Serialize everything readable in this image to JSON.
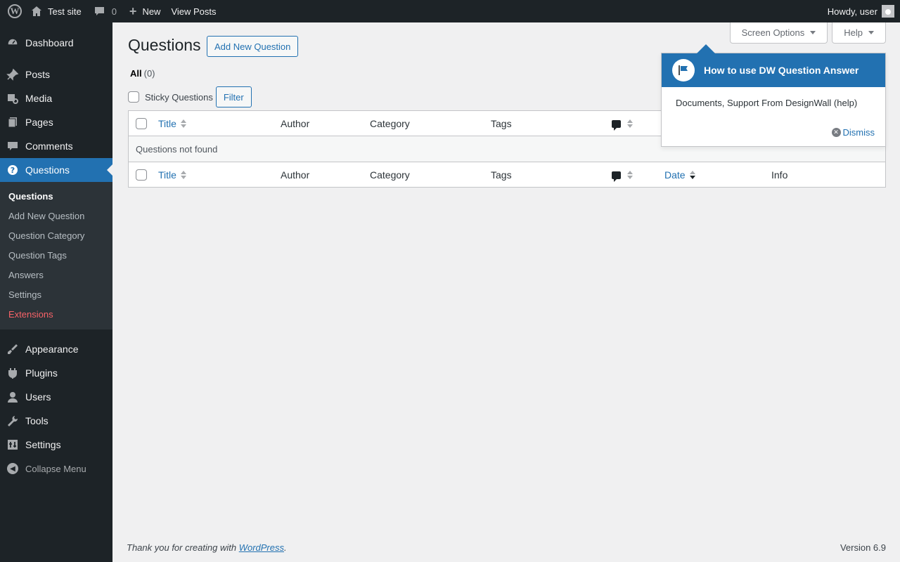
{
  "adminbar": {
    "site_name": "Test site",
    "comments_count": "0",
    "new_label": "New",
    "view_posts": "View Posts",
    "howdy": "Howdy, user"
  },
  "sidebar": {
    "items_top": [
      {
        "label": "Dashboard",
        "icon": "dashboard-icon"
      },
      {
        "label": "Posts",
        "icon": "pin-icon"
      },
      {
        "label": "Media",
        "icon": "media-icon"
      },
      {
        "label": "Pages",
        "icon": "pages-icon"
      },
      {
        "label": "Comments",
        "icon": "comment-icon"
      },
      {
        "label": "Questions",
        "icon": "question-icon"
      }
    ],
    "submenu": [
      "Questions",
      "Add New Question",
      "Question Category",
      "Question Tags",
      "Answers",
      "Settings",
      "Extensions"
    ],
    "items_bottom": [
      {
        "label": "Appearance",
        "icon": "brush-icon"
      },
      {
        "label": "Plugins",
        "icon": "plugin-icon"
      },
      {
        "label": "Users",
        "icon": "user-icon"
      },
      {
        "label": "Tools",
        "icon": "wrench-icon"
      },
      {
        "label": "Settings",
        "icon": "settings-icon"
      }
    ],
    "collapse": "Collapse Menu"
  },
  "main": {
    "title": "Questions",
    "add_button": "Add New Question",
    "screen_options": "Screen Options",
    "help": "Help",
    "filter_all": "All",
    "filter_all_count": "(0)",
    "sticky_label": "Sticky Questions",
    "filter_button": "Filter",
    "columns": {
      "title": "Title",
      "author": "Author",
      "category": "Category",
      "tags": "Tags",
      "date": "Date",
      "info": "Info"
    },
    "empty_message": "Questions not found"
  },
  "pointer": {
    "title": "How to use DW Question Answer",
    "body": "Documents, Support From DesignWall (help)",
    "dismiss": "Dismiss"
  },
  "footer": {
    "thanks_prefix": "Thank you for creating with ",
    "thanks_link": "WordPress",
    "thanks_suffix": ".",
    "version": "Version 6.9"
  },
  "colors": {
    "admin_dark": "#1d2327",
    "accent": "#2271b1",
    "extensions_red": "#f86368"
  }
}
